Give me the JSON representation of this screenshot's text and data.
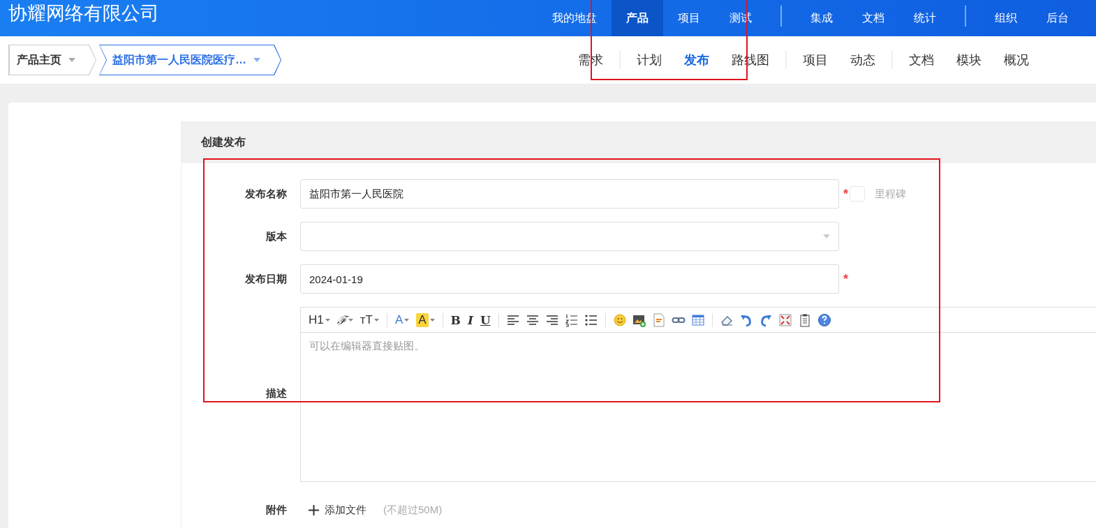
{
  "header": {
    "logo": "协耀网络有限公司",
    "nav_groups": [
      [
        {
          "label": "我的地盘",
          "selected": false
        },
        {
          "label": "产品",
          "selected": true
        },
        {
          "label": "项目",
          "selected": false
        },
        {
          "label": "测试",
          "selected": false
        }
      ],
      [
        {
          "label": "集成",
          "selected": false
        },
        {
          "label": "文档",
          "selected": false
        },
        {
          "label": "统计",
          "selected": false
        }
      ],
      [
        {
          "label": "组织",
          "selected": false
        },
        {
          "label": "后台",
          "selected": false
        }
      ]
    ]
  },
  "breadcrumb": [
    {
      "label": "产品主页",
      "selected": false
    },
    {
      "label": "益阳市第一人民医院医疗…",
      "selected": true
    }
  ],
  "subnav_groups": [
    [
      {
        "label": "需求",
        "selected": false
      }
    ],
    [
      {
        "label": "计划",
        "selected": false
      },
      {
        "label": "发布",
        "selected": true
      },
      {
        "label": "路线图",
        "selected": false
      }
    ],
    [
      {
        "label": "项目",
        "selected": false
      },
      {
        "label": "动态",
        "selected": false
      }
    ],
    [
      {
        "label": "文档",
        "selected": false
      },
      {
        "label": "模块",
        "selected": false
      },
      {
        "label": "概况",
        "selected": false
      }
    ]
  ],
  "form": {
    "title": "创建发布",
    "fields": [
      {
        "kind": "text",
        "label": "发布名称",
        "value": "益阳市第一人民医院",
        "required_mark": "*",
        "milestone": {
          "label": "里程碑",
          "checked": false
        }
      },
      {
        "kind": "select",
        "label": "版本"
      },
      {
        "kind": "text",
        "label": "发布日期",
        "value": "2024-01-19",
        "required_mark": "*"
      },
      {
        "kind": "editor",
        "label": "描述",
        "placeholder": "可以在编辑器直接贴图。",
        "toolbar": [
          {
            "kind": "text",
            "label": "H1"
          },
          {
            "kind": "text",
            "label": "ℱ"
          },
          {
            "kind": "text",
            "label": "ᴛT"
          },
          {
            "kind": "separator"
          },
          {
            "kind": "text",
            "label": "A"
          },
          {
            "kind": "text",
            "label": "A"
          },
          {
            "kind": "separator"
          },
          {
            "kind": "text",
            "label": "B"
          },
          {
            "kind": "text",
            "label": "I"
          },
          {
            "kind": "text",
            "label": "U"
          },
          {
            "kind": "separator"
          },
          {
            "kind": "icon"
          },
          {
            "kind": "icon"
          },
          {
            "kind": "icon"
          },
          {
            "kind": "icon"
          },
          {
            "kind": "icon"
          },
          {
            "kind": "separator"
          },
          {
            "kind": "icon"
          },
          {
            "kind": "icon"
          },
          {
            "kind": "icon"
          },
          {
            "kind": "icon"
          },
          {
            "kind": "icon"
          },
          {
            "kind": "separator"
          },
          {
            "kind": "icon"
          },
          {
            "kind": "icon"
          },
          {
            "kind": "icon"
          },
          {
            "kind": "icon"
          },
          {
            "kind": "icon"
          },
          {
            "kind": "icon"
          }
        ]
      },
      {
        "kind": "attachment",
        "label": "附件",
        "button": "添加文件",
        "hint": "(不超过50M)"
      }
    ]
  },
  "annotations": [
    {
      "kind": "red_box"
    },
    {
      "kind": "red_box"
    }
  ]
}
